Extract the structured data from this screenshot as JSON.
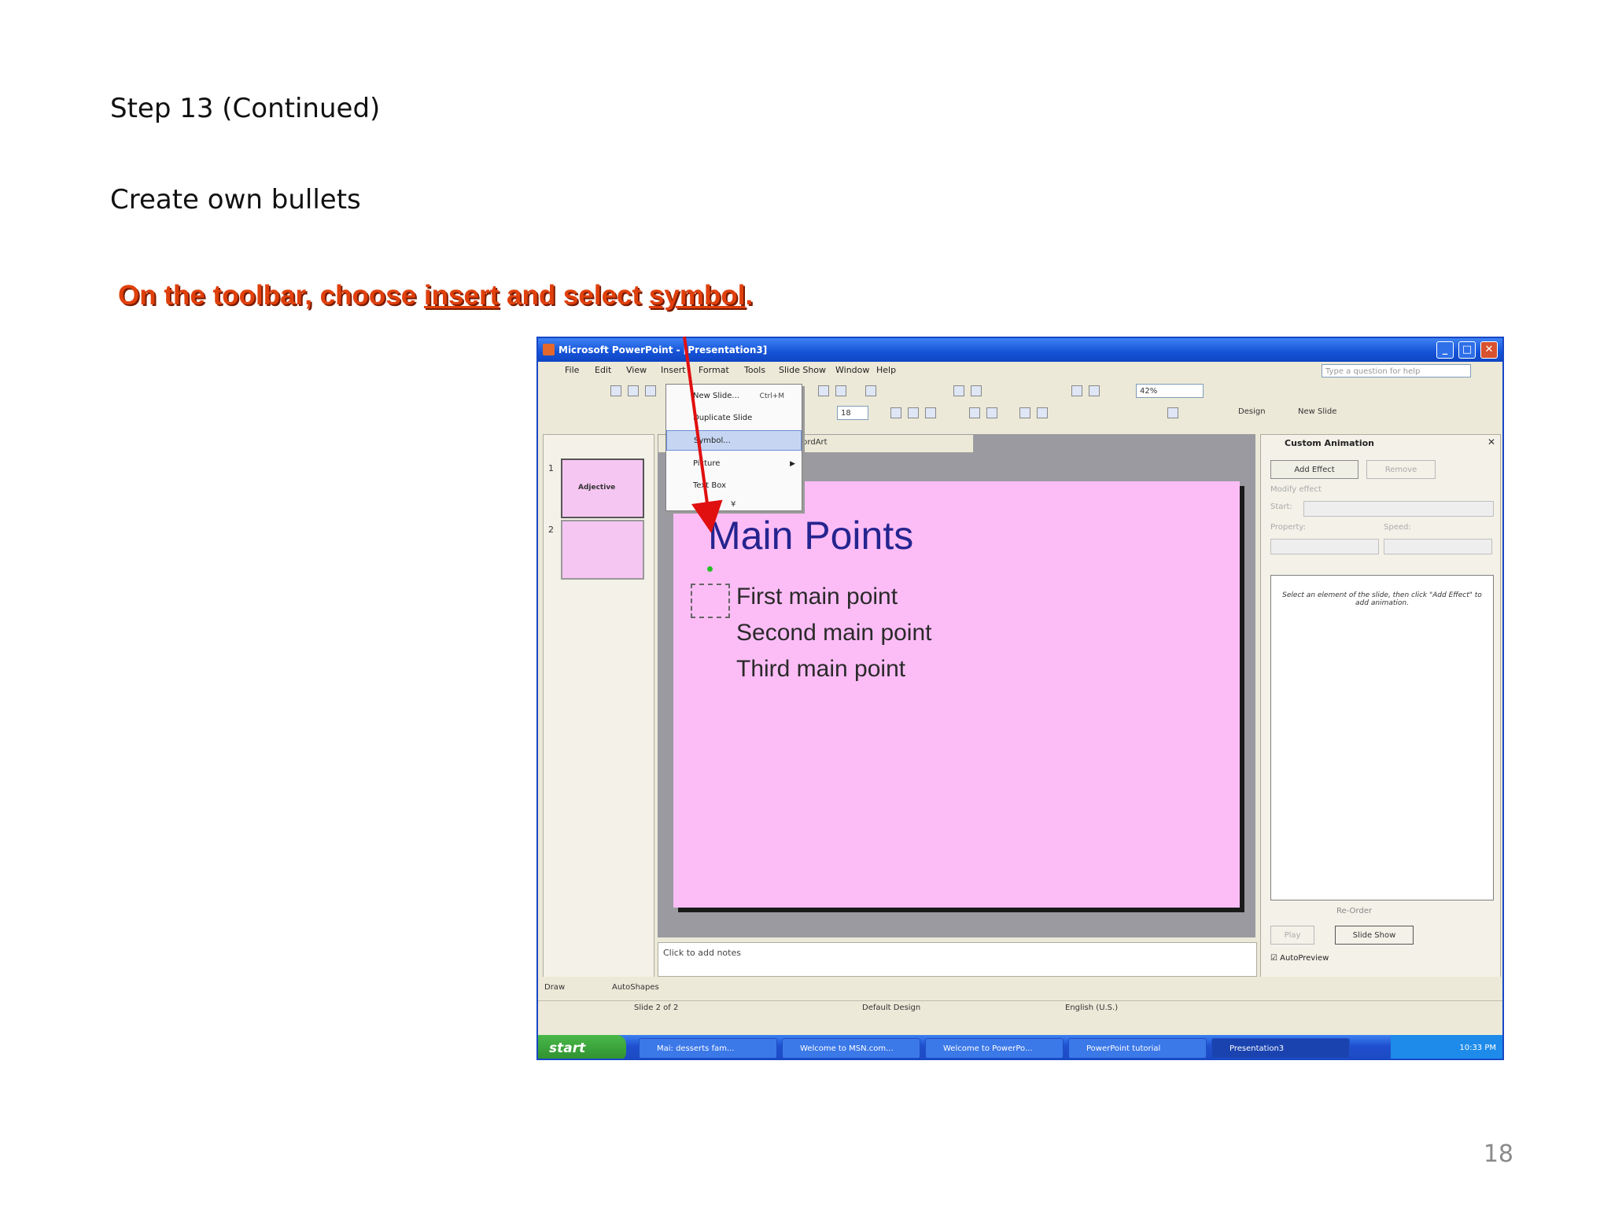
{
  "page": {
    "heading": "Step 13  (Continued)",
    "subheading": "Create own bullets",
    "instruction": {
      "part1": "On the toolbar, choose ",
      "link1": "insert",
      "part2": " and select ",
      "link2": "symbol",
      "part3": "."
    },
    "page_number": "18"
  },
  "window": {
    "title": "Microsoft PowerPoint - [Presentation3]",
    "menu": [
      "File",
      "Edit",
      "View",
      "Insert",
      "Format",
      "Tools",
      "Slide Show",
      "Window",
      "Help"
    ],
    "help_placeholder": "Type a question for help",
    "zoom": "42%",
    "font_size": "18",
    "design_label": "Design",
    "new_slide_label": "New Slide"
  },
  "insert_menu": {
    "items": [
      {
        "label": "New Slide...",
        "shortcut": "Ctrl+M"
      },
      {
        "label": "Duplicate Slide",
        "shortcut": ""
      },
      {
        "label": "Symbol...",
        "shortcut": ""
      },
      {
        "label": "Picture",
        "shortcut": ""
      },
      {
        "label": "Text Box",
        "shortcut": ""
      }
    ]
  },
  "thumbnails": {
    "slide1_text": "Adjective",
    "numbers": [
      "1",
      "2"
    ]
  },
  "slide": {
    "title": "Main Points",
    "bullets": [
      "First main point",
      "Second main point",
      "Third main point"
    ]
  },
  "floating_toolbar": {
    "title": "WordArt"
  },
  "notes": {
    "placeholder": "Click to add notes"
  },
  "task_pane": {
    "title": "Custom Animation",
    "add_effect": "Add Effect",
    "remove": "Remove",
    "modify": "Modify effect",
    "start": "Start:",
    "property": "Property:",
    "speed": "Speed:",
    "hint": "Select an element of the slide, then click \"Add Effect\" to add animation.",
    "reorder": "Re-Order",
    "play": "Play",
    "slide_show": "Slide Show",
    "autopreview": "AutoPreview"
  },
  "drawing": {
    "draw": "Draw",
    "autoshapes": "AutoShapes"
  },
  "status": {
    "slide": "Slide 2 of 2",
    "design": "Default Design",
    "language": "English (U.S.)"
  },
  "taskbar": {
    "start": "start",
    "items": [
      "Mai: desserts fam...",
      "Welcome to MSN.com...",
      "Welcome to PowerPo...",
      "PowerPoint tutorial",
      "Presentation3"
    ],
    "clock": "10:33 PM"
  }
}
